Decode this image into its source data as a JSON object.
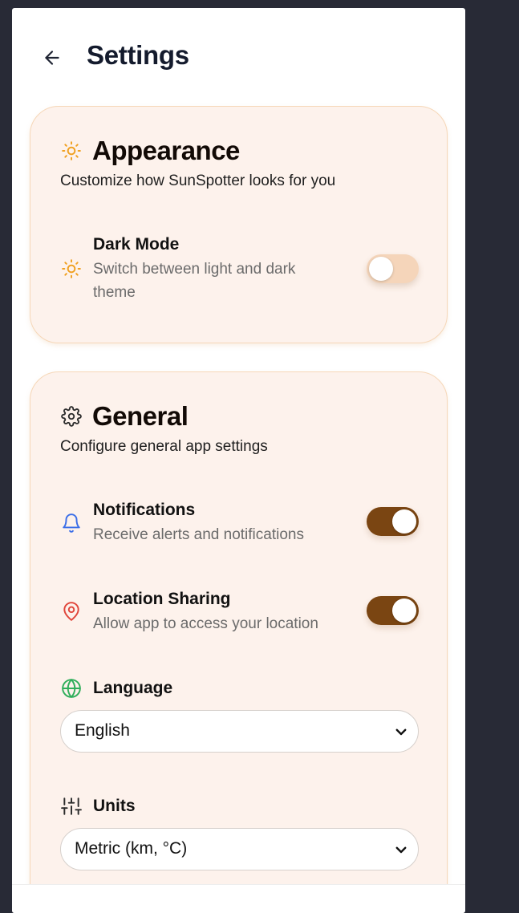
{
  "header": {
    "title": "Settings",
    "back_icon": "arrow-left-icon"
  },
  "appearance": {
    "title": "Appearance",
    "subtitle": "Customize how SunSpotter looks for you",
    "icon": "sun-icon",
    "dark_mode": {
      "label": "Dark Mode",
      "description_line1": "Switch between light and dark",
      "description_line2": "theme",
      "icon": "sun-icon",
      "enabled": false
    }
  },
  "general": {
    "title": "General",
    "subtitle": "Configure general app settings",
    "icon": "gear-icon",
    "notifications": {
      "label": "Notifications",
      "description": "Receive alerts and notifications",
      "icon": "bell-icon",
      "enabled": true
    },
    "location_sharing": {
      "label": "Location Sharing",
      "description": "Allow app to access your location",
      "icon": "map-pin-icon",
      "enabled": true
    },
    "language": {
      "label": "Language",
      "icon": "globe-icon",
      "selected": "English"
    },
    "units": {
      "label": "Units",
      "icon": "sliders-icon",
      "selected": "Metric (km, °C)"
    }
  },
  "colors": {
    "accent_brown": "#7a4512",
    "card_bg": "#fdf2ec",
    "sun_orange": "#f0a020",
    "bell_blue": "#3b6ee8",
    "pin_red": "#e0453a",
    "globe_green": "#2fae5a"
  }
}
